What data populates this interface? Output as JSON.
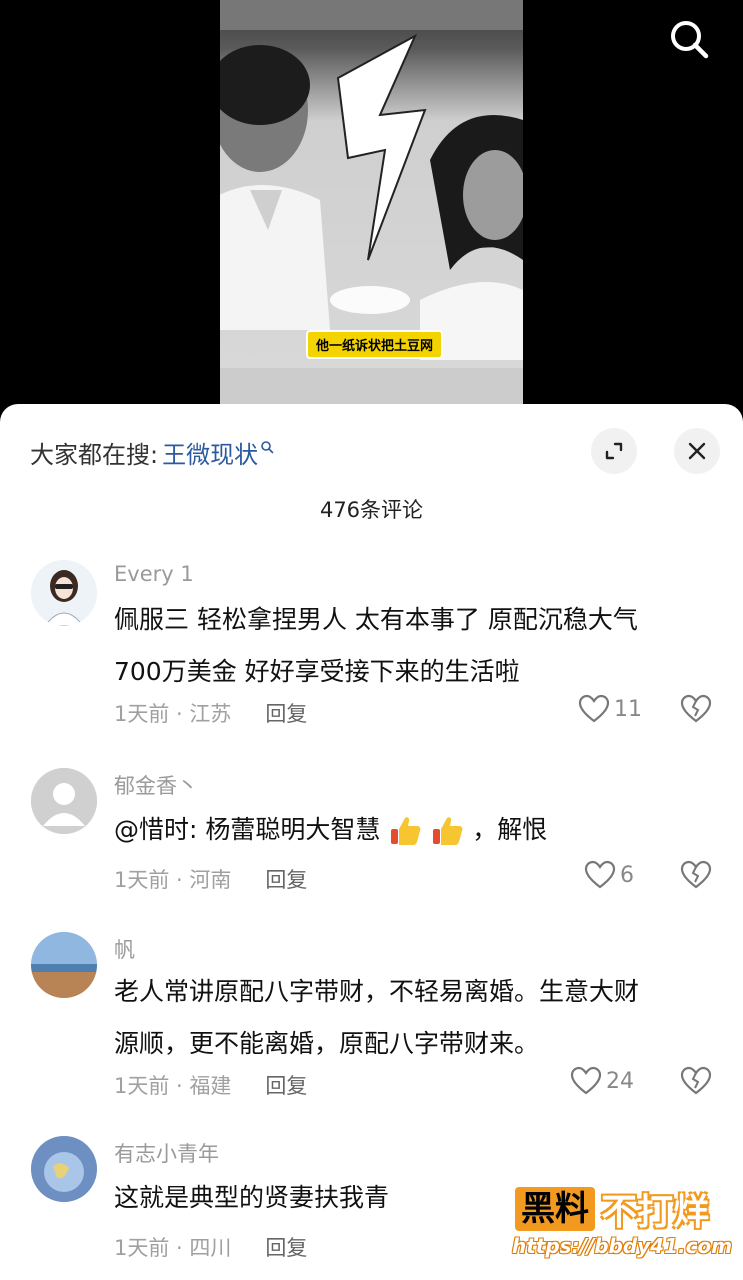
{
  "video": {
    "caption": "他一纸诉状把土豆网"
  },
  "header": {
    "search_prefix": "大家都在搜:",
    "search_term": "王微现状"
  },
  "comment_count": "476条评论",
  "comments": [
    {
      "username": "Every 1",
      "lines": [
        "佩服三 轻松拿捏男人 太有本事了 原配沉稳大气",
        "700万美金 好好享受接下来的生活啦"
      ],
      "meta": "1天前 · 江苏",
      "reply": "回复",
      "likes": "11"
    },
    {
      "username": "郁金香丶",
      "text_before": "@惜时: 杨蕾聪明大智慧",
      "text_after": "，解恨",
      "meta": "1天前 · 河南",
      "reply": "回复",
      "likes": "6"
    },
    {
      "username": "帆",
      "lines": [
        "老人常讲原配八字带财，不轻易离婚。生意大财",
        "源顺，更不能离婚，原配八字带财来。"
      ],
      "meta": "1天前 · 福建",
      "reply": "回复",
      "likes": "24"
    },
    {
      "username": "有志小青年",
      "lines": [
        "这就是典型的贤妻扶我青"
      ],
      "meta": "1天前 · 四川",
      "reply": "回复",
      "likes": ""
    }
  ],
  "watermark": {
    "brand_a": "黑料",
    "brand_b": "不打烊",
    "url": "https://bbdy41.com"
  },
  "colors": {
    "accent_link": "#2c5a9e",
    "banner": "#f3d400",
    "watermark_orange": "#f29a1f"
  }
}
